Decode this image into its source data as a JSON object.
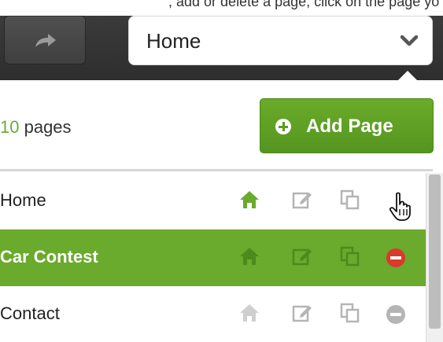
{
  "caption": ", add or delete a page, click on the page yo",
  "toolbar": {
    "redo_icon": "redo-arrow-icon",
    "page_select_value": "Home",
    "chevron_icon": "chevron-down-icon"
  },
  "panel": {
    "page_count": "10",
    "page_count_label": " pages",
    "add_button_label": "Add Page",
    "add_icon": "plus-circle-icon"
  },
  "pages": [
    {
      "name": "Home",
      "selected": false,
      "is_home": true
    },
    {
      "name": "Car Contest",
      "selected": true,
      "is_home": false
    },
    {
      "name": "Contact",
      "selected": false,
      "is_home": false
    }
  ],
  "colors": {
    "accent_green": "#6aaa2c",
    "icon_grey": "#b5b5b5",
    "delete_red": "#d93a2b",
    "toolbar_dark": "#363636"
  }
}
